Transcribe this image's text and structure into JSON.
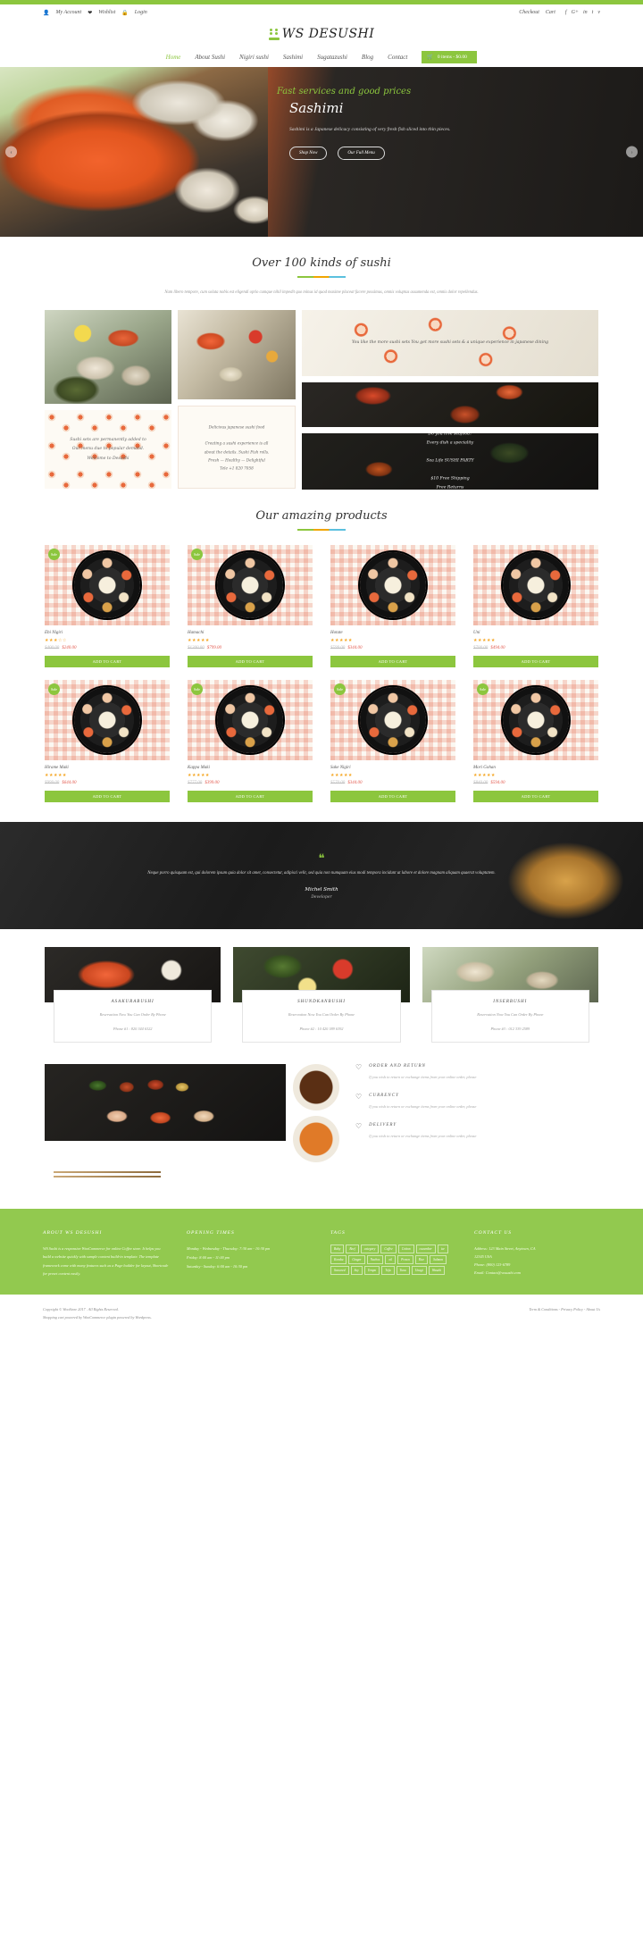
{
  "theme": {
    "accent": "#8cc63e",
    "footer_bg": "#92c94f",
    "price": "#e2574c"
  },
  "topbar": {
    "left": [
      {
        "icon": "user-icon",
        "label": "My Account"
      },
      {
        "icon": "heart-icon",
        "label": "Wishlist"
      },
      {
        "icon": "lock-icon",
        "label": "Login"
      }
    ],
    "right": [
      {
        "label": "Checkout"
      },
      {
        "label": "Cart"
      }
    ],
    "social": [
      "f",
      "G+",
      "in",
      "t",
      "v"
    ]
  },
  "logo": {
    "text": "WS DESUSHI",
    "mark": "sushi-logo-icon"
  },
  "nav": {
    "items": [
      {
        "label": "Home",
        "active": true
      },
      {
        "label": "About Sushi",
        "active": false
      },
      {
        "label": "Nigiri sushi",
        "active": false
      },
      {
        "label": "Sashimi",
        "active": false
      },
      {
        "label": "Sugatazushi",
        "active": false
      },
      {
        "label": "Blog",
        "active": false
      },
      {
        "label": "Contact",
        "active": false
      }
    ],
    "cart": {
      "label": "0 items - $0.00",
      "icon": "cart-icon"
    }
  },
  "hero": {
    "kicker": "Fast services and good prices",
    "title": "Sashimi",
    "subtitle": "Sashimi is a Japanese delicacy consisting of very fresh fish sliced into thin pieces.",
    "buttons": [
      {
        "label": "Shop Now"
      },
      {
        "label": "Our Full Menu"
      }
    ],
    "prev": "prev-slide-arrow",
    "next": "next-slide-arrow"
  },
  "sushi_section": {
    "title": "Over 100 kinds of sushi",
    "subtitle": "Nam libero tempore, cum soluta nobis est eligendi optio cumque nihil impedit quo minus id quod maxime placeat facere possimus, omnis voluptas assumenda est, omnis dolor repellendus.",
    "cells": [
      {
        "name": "seafood-platter-image",
        "caption": ""
      },
      {
        "name": "sushi-pattern-tile",
        "caption": "Sushi sets are permanently added to\nOur menu due to popular demand.\nWelcome to Desushi"
      },
      {
        "name": "salmon-board-image",
        "caption": ""
      },
      {
        "name": "delicious-japanese-card",
        "caption": "Delicious japanese sushi food\n\nCreating a sushi experience is all\nabout the details. Sushi Fish rolls.\nFresh — Healthy — Delightful\nTele +1 820 7058"
      },
      {
        "name": "sushi-rolls-image",
        "caption": "You like the more sushi sets\n\nYou get more sushi sets & a unique\nexperience in japanese dining"
      },
      {
        "name": "seafood-dark-image",
        "caption": "Do you love seafood?\nEvery dish a speciality\n\nSea Life SUSHI PARTY\n\n$10     Free Shipping\nFree Returns"
      }
    ]
  },
  "products_section": {
    "title": "Our amazing products",
    "add_to_cart": "ADD TO CART",
    "sale_badge": "Sale",
    "items": [
      {
        "name": "Ebi Nigiri",
        "stars": "★★★☆☆",
        "old": "$400.00",
        "new": "$240.00",
        "sale": true
      },
      {
        "name": "Hamachi",
        "stars": "★★★★★",
        "old": "$1200.00",
        "new": "$799.00",
        "sale": true
      },
      {
        "name": "Hotate",
        "stars": "★★★★★",
        "old": "$599.00",
        "new": "$344.00",
        "sale": false
      },
      {
        "name": "Uni",
        "stars": "★★★★★",
        "old": "$700.00",
        "new": "$494.00",
        "sale": false
      },
      {
        "name": "Hirame Maki",
        "stars": "★★★★★",
        "old": "$999.00",
        "new": "$644.00",
        "sale": true
      },
      {
        "name": "Kappa Maki",
        "stars": "★★★★★",
        "old": "$777.00",
        "new": "$399.00",
        "sale": true
      },
      {
        "name": "Sake Nigiri",
        "stars": "★★★★★",
        "old": "$570.00",
        "new": "$344.00",
        "sale": true
      },
      {
        "name": "Mori Gohan",
        "stars": "★★★★★",
        "old": "$840.00",
        "new": "$594.00",
        "sale": true
      }
    ]
  },
  "testimonial": {
    "quote_icon": "quote-icon",
    "text": "Neque porro quisquam est, qui dolorem ipsum quia dolor sit amet, consectetur, adipisci velit, sed quia non numquam eius modi tempora incidunt ut labore et dolore magnam aliquam quaerat voluptatem.",
    "name": "Michel Smith",
    "role": "Developer"
  },
  "reservations": [
    {
      "image": "salmon-garlic-image",
      "title": "ASAKURABUSHI",
      "line": "Reservation Now You Can Order By Phone",
      "phone": "Phone #1 : 820 344 6322"
    },
    {
      "image": "vegetables-image",
      "title": "SHUNDKANBUSHI",
      "line": "Reservation Now You Can Order By Phone",
      "phone": "Phone #2 : 10 420 389 6392"
    },
    {
      "image": "shellfish-image",
      "title": "INSERBUSHI",
      "line": "Reservation Now You Can Order By Phone",
      "phone": "Phone #3 : 012 339 2589"
    }
  ],
  "services": {
    "items": [
      {
        "icon": "heart-icon",
        "title": "ORDER AND RETURN",
        "text": "If you wish to return or exchange items from your online order, please"
      },
      {
        "icon": "heart-icon",
        "title": "CURRENCY",
        "text": "If you wish to return or exchange items from your online order, please"
      },
      {
        "icon": "heart-icon",
        "title": "DELIVERY",
        "text": "If you wish to return or exchange items from your online order, please"
      }
    ],
    "images": [
      "nigiri-plate-image",
      "soy-bowl-image",
      "sauce-bowl-image",
      "chopsticks-image"
    ]
  },
  "footer": {
    "columns": [
      {
        "title": "ABOUT WS DESUSHI",
        "text": "WS Sushi is a responsive WooCommerce for online Coffee store. It helps you build a website quickly with sample content build-in template. The template framework come with many features such as a Page builder for layout, Shortcode for preset content easily."
      },
      {
        "title": "OPENING TIMES",
        "rows": [
          "Monday - Wednesday - Thursday: 7:30 am - 10:30 pm",
          "Friday: 8:00 am - 11:00 pm",
          "Saturday - Sunday: 6:00 am - 10:30 pm"
        ]
      },
      {
        "title": "TAGS",
        "tags": [
          "Baby",
          "Beef",
          "category",
          "Coffee",
          "Cotton",
          "cucumber",
          "ice",
          "Kombu",
          "Ginger",
          "Nachos",
          "oil",
          "Prawn",
          "Rice",
          "Salmon",
          "Seaweed",
          "Soy",
          "Tempo",
          "Tofu",
          "Tuna",
          "Unagi",
          "Wasabi"
        ]
      },
      {
        "title": "CONTACT US",
        "address": "Address: 123 Main Street, Anytown, CA",
        "zip": "12345 USA",
        "phone": "Phone: (800) 123-6789",
        "email": "Email: Contact@wssushi.com"
      }
    ],
    "bottom_left_1": "Copyright © WooStore 2017 . All Rights Reserved.",
    "bottom_left_2": "Shopping cart powered by WooCommerce plugin powered by Wordpress.",
    "bottom_right": "Term & Conditions - Privacy Policy - About Us"
  }
}
